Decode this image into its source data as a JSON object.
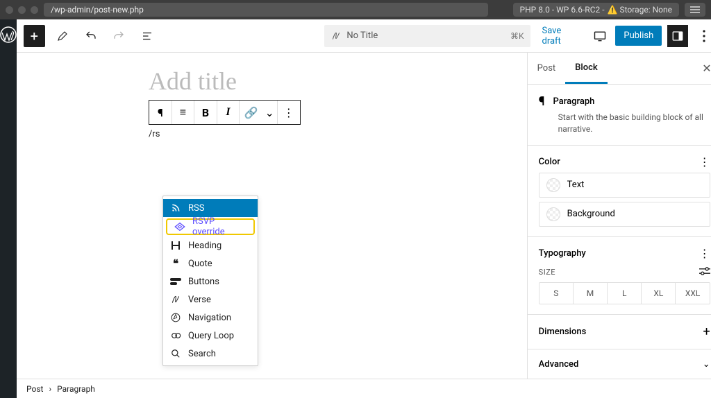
{
  "chrome": {
    "url": "/wp-admin/post-new.php",
    "status": "PHP 8.0 - WP 6.6-RC2 - ",
    "storage_warn": "⚠️ Storage: None"
  },
  "toolbar": {
    "command_placeholder": "No Title",
    "keyboard": "⌘K",
    "save_draft": "Save draft",
    "publish": "Publish"
  },
  "editor": {
    "title_placeholder": "Add title",
    "slash_input": "/rs"
  },
  "block_toolbar": [
    "¶",
    "≡",
    "B",
    "I",
    "🔗",
    "⌄",
    "⋮"
  ],
  "popup_items": [
    {
      "icon": "rss",
      "label": "RSS",
      "state": "selected"
    },
    {
      "icon": "override",
      "label": "RSVP override",
      "state": "highlight"
    },
    {
      "icon": "heading",
      "label": "Heading",
      "state": ""
    },
    {
      "icon": "quote",
      "label": "Quote",
      "state": ""
    },
    {
      "icon": "buttons",
      "label": "Buttons",
      "state": ""
    },
    {
      "icon": "verse",
      "label": "Verse",
      "state": ""
    },
    {
      "icon": "nav",
      "label": "Navigation",
      "state": ""
    },
    {
      "icon": "loop",
      "label": "Query Loop",
      "state": ""
    },
    {
      "icon": "search",
      "label": "Search",
      "state": ""
    }
  ],
  "sidebar": {
    "tabs": {
      "post": "Post",
      "block": "Block"
    },
    "block_name": "Paragraph",
    "block_desc": "Start with the basic building block of all narrative.",
    "sections": {
      "color": "Color",
      "color_text": "Text",
      "color_bg": "Background",
      "typography": "Typography",
      "size_label": "Size",
      "sizes": [
        "S",
        "M",
        "L",
        "XL",
        "XXL"
      ],
      "dimensions": "Dimensions",
      "advanced": "Advanced"
    }
  },
  "breadcrumb": [
    "Post",
    "Paragraph"
  ]
}
